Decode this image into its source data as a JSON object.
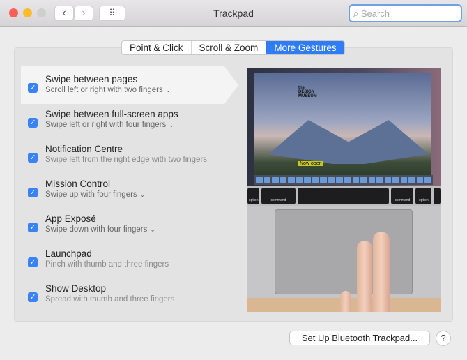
{
  "window": {
    "title": "Trackpad"
  },
  "toolbar": {
    "back_icon": "‹",
    "forward_icon": "›",
    "grid_icon": "⠿",
    "search_placeholder": "Search",
    "search_icon": "⌕"
  },
  "tabs": [
    {
      "label": "Point & Click"
    },
    {
      "label": "Scroll & Zoom"
    },
    {
      "label": "More Gestures",
      "active": true
    }
  ],
  "gestures": [
    {
      "title": "Swipe between pages",
      "subtitle": "Scroll left or right with two fingers",
      "dropdown": true,
      "checked": true
    },
    {
      "title": "Swipe between full-screen apps",
      "subtitle": "Swipe left or right with four fingers",
      "dropdown": true,
      "checked": true
    },
    {
      "title": "Notification Centre",
      "subtitle": "Swipe left from the right edge with two fingers",
      "dropdown": false,
      "checked": true
    },
    {
      "title": "Mission Control",
      "subtitle": "Swipe up with four fingers",
      "dropdown": true,
      "checked": true
    },
    {
      "title": "App Exposé",
      "subtitle": "Swipe down with four fingers",
      "dropdown": true,
      "checked": true
    },
    {
      "title": "Launchpad",
      "subtitle": "Pinch with thumb and three fingers",
      "dropdown": false,
      "checked": true
    },
    {
      "title": "Show Desktop",
      "subtitle": "Spread with thumb and three fingers",
      "dropdown": false,
      "checked": true
    }
  ],
  "preview": {
    "logo": "the DESIGN MUSEUM",
    "caption": "Now open",
    "keys": [
      "option",
      "command",
      "command",
      "option"
    ]
  },
  "footer": {
    "setup_button": "Set Up Bluetooth Trackpad...",
    "help": "?"
  },
  "colors": {
    "accent": "#2f7cf6",
    "checkbox": "#3a82f7"
  }
}
